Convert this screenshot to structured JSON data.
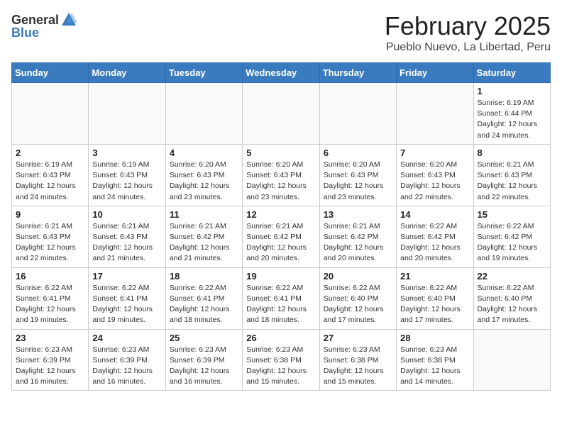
{
  "header": {
    "logo_general": "General",
    "logo_blue": "Blue",
    "month": "February 2025",
    "location": "Pueblo Nuevo, La Libertad, Peru"
  },
  "weekdays": [
    "Sunday",
    "Monday",
    "Tuesday",
    "Wednesday",
    "Thursday",
    "Friday",
    "Saturday"
  ],
  "weeks": [
    [
      {
        "day": "",
        "info": ""
      },
      {
        "day": "",
        "info": ""
      },
      {
        "day": "",
        "info": ""
      },
      {
        "day": "",
        "info": ""
      },
      {
        "day": "",
        "info": ""
      },
      {
        "day": "",
        "info": ""
      },
      {
        "day": "1",
        "info": "Sunrise: 6:19 AM\nSunset: 6:44 PM\nDaylight: 12 hours\nand 24 minutes."
      }
    ],
    [
      {
        "day": "2",
        "info": "Sunrise: 6:19 AM\nSunset: 6:43 PM\nDaylight: 12 hours\nand 24 minutes."
      },
      {
        "day": "3",
        "info": "Sunrise: 6:19 AM\nSunset: 6:43 PM\nDaylight: 12 hours\nand 24 minutes."
      },
      {
        "day": "4",
        "info": "Sunrise: 6:20 AM\nSunset: 6:43 PM\nDaylight: 12 hours\nand 23 minutes."
      },
      {
        "day": "5",
        "info": "Sunrise: 6:20 AM\nSunset: 6:43 PM\nDaylight: 12 hours\nand 23 minutes."
      },
      {
        "day": "6",
        "info": "Sunrise: 6:20 AM\nSunset: 6:43 PM\nDaylight: 12 hours\nand 23 minutes."
      },
      {
        "day": "7",
        "info": "Sunrise: 6:20 AM\nSunset: 6:43 PM\nDaylight: 12 hours\nand 22 minutes."
      },
      {
        "day": "8",
        "info": "Sunrise: 6:21 AM\nSunset: 6:43 PM\nDaylight: 12 hours\nand 22 minutes."
      }
    ],
    [
      {
        "day": "9",
        "info": "Sunrise: 6:21 AM\nSunset: 6:43 PM\nDaylight: 12 hours\nand 22 minutes."
      },
      {
        "day": "10",
        "info": "Sunrise: 6:21 AM\nSunset: 6:43 PM\nDaylight: 12 hours\nand 21 minutes."
      },
      {
        "day": "11",
        "info": "Sunrise: 6:21 AM\nSunset: 6:42 PM\nDaylight: 12 hours\nand 21 minutes."
      },
      {
        "day": "12",
        "info": "Sunrise: 6:21 AM\nSunset: 6:42 PM\nDaylight: 12 hours\nand 20 minutes."
      },
      {
        "day": "13",
        "info": "Sunrise: 6:21 AM\nSunset: 6:42 PM\nDaylight: 12 hours\nand 20 minutes."
      },
      {
        "day": "14",
        "info": "Sunrise: 6:22 AM\nSunset: 6:42 PM\nDaylight: 12 hours\nand 20 minutes."
      },
      {
        "day": "15",
        "info": "Sunrise: 6:22 AM\nSunset: 6:42 PM\nDaylight: 12 hours\nand 19 minutes."
      }
    ],
    [
      {
        "day": "16",
        "info": "Sunrise: 6:22 AM\nSunset: 6:41 PM\nDaylight: 12 hours\nand 19 minutes."
      },
      {
        "day": "17",
        "info": "Sunrise: 6:22 AM\nSunset: 6:41 PM\nDaylight: 12 hours\nand 19 minutes."
      },
      {
        "day": "18",
        "info": "Sunrise: 6:22 AM\nSunset: 6:41 PM\nDaylight: 12 hours\nand 18 minutes."
      },
      {
        "day": "19",
        "info": "Sunrise: 6:22 AM\nSunset: 6:41 PM\nDaylight: 12 hours\nand 18 minutes."
      },
      {
        "day": "20",
        "info": "Sunrise: 6:22 AM\nSunset: 6:40 PM\nDaylight: 12 hours\nand 17 minutes."
      },
      {
        "day": "21",
        "info": "Sunrise: 6:22 AM\nSunset: 6:40 PM\nDaylight: 12 hours\nand 17 minutes."
      },
      {
        "day": "22",
        "info": "Sunrise: 6:22 AM\nSunset: 6:40 PM\nDaylight: 12 hours\nand 17 minutes."
      }
    ],
    [
      {
        "day": "23",
        "info": "Sunrise: 6:23 AM\nSunset: 6:39 PM\nDaylight: 12 hours\nand 16 minutes."
      },
      {
        "day": "24",
        "info": "Sunrise: 6:23 AM\nSunset: 6:39 PM\nDaylight: 12 hours\nand 16 minutes."
      },
      {
        "day": "25",
        "info": "Sunrise: 6:23 AM\nSunset: 6:39 PM\nDaylight: 12 hours\nand 16 minutes."
      },
      {
        "day": "26",
        "info": "Sunrise: 6:23 AM\nSunset: 6:38 PM\nDaylight: 12 hours\nand 15 minutes."
      },
      {
        "day": "27",
        "info": "Sunrise: 6:23 AM\nSunset: 6:38 PM\nDaylight: 12 hours\nand 15 minutes."
      },
      {
        "day": "28",
        "info": "Sunrise: 6:23 AM\nSunset: 6:38 PM\nDaylight: 12 hours\nand 14 minutes."
      },
      {
        "day": "",
        "info": ""
      }
    ]
  ]
}
